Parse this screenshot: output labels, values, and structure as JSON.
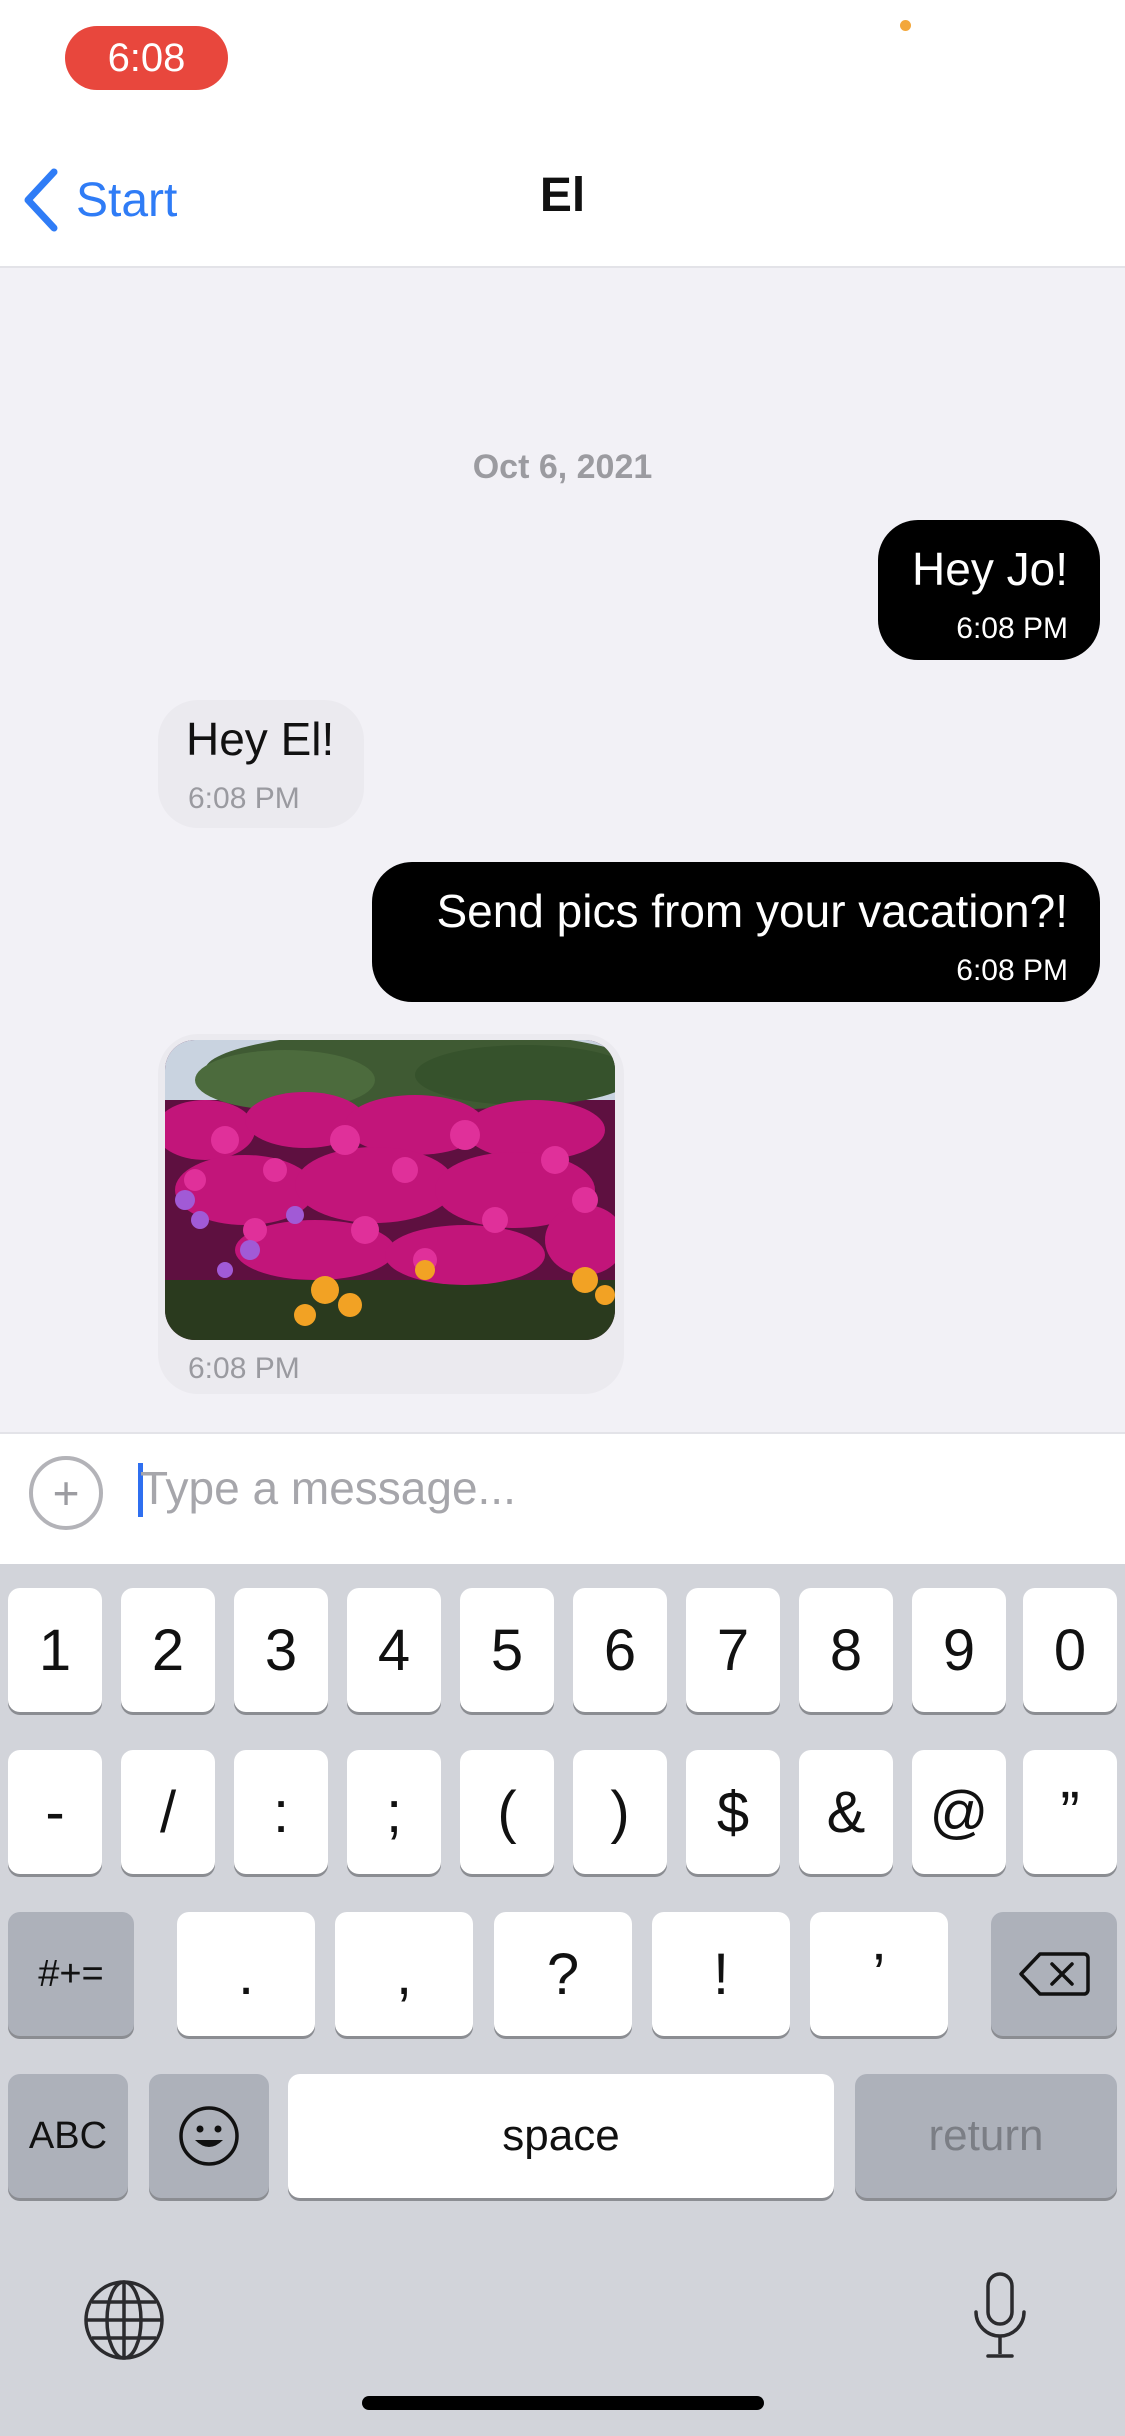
{
  "status_bar": {
    "time": "6:08"
  },
  "nav": {
    "back_label": "Start",
    "title": "El"
  },
  "chat": {
    "date": "Oct 6, 2021",
    "messages": [
      {
        "text": "Hey Jo!",
        "time": "6:08 PM",
        "direction": "outgoing"
      },
      {
        "text": "Hey El!",
        "time": "6:08 PM",
        "direction": "incoming"
      },
      {
        "text": "Send pics from your vacation?!",
        "time": "6:08 PM",
        "direction": "outgoing"
      },
      {
        "text": "",
        "time": "6:08 PM",
        "direction": "incoming",
        "attachment": "photo of magenta and yellow flowers"
      }
    ]
  },
  "composer": {
    "placeholder": "Type a message...",
    "value": "",
    "attach_icon": "plus-circle-icon"
  },
  "keyboard": {
    "row1": [
      "1",
      "2",
      "3",
      "4",
      "5",
      "6",
      "7",
      "8",
      "9",
      "0"
    ],
    "row2": [
      "-",
      "/",
      ":",
      ";",
      "(",
      ")",
      "$",
      "&",
      "@",
      "”"
    ],
    "row3_mode": "#+=",
    "row3": [
      ".",
      ",",
      "?",
      "!",
      "’"
    ],
    "row4": {
      "abc": "ABC",
      "space": "space",
      "return": "return"
    },
    "icons": [
      "delete-icon",
      "emoji-icon",
      "globe-icon",
      "microphone-icon"
    ]
  },
  "colors": {
    "accent": "#2f7cf6",
    "time_pill": "#e8473d",
    "outgoing_bubble": "#000000",
    "incoming_bubble": "#ebeaef",
    "chat_background": "#f2f1f6",
    "keyboard_background": "#d2d4da"
  }
}
